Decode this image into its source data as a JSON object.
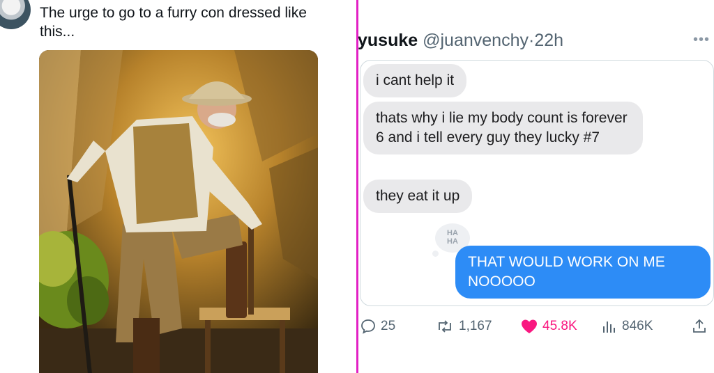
{
  "left_tweet": {
    "text": "The urge to go to a furry con dressed like this..."
  },
  "right_tweet": {
    "display_name": "yusuke",
    "handle": "@juanvenchy",
    "separator": "·",
    "time": "22h",
    "more_label": "•••",
    "messages": [
      {
        "side": "received",
        "text": "i cant help it"
      },
      {
        "side": "received",
        "text": "thats why i lie my body count is forever 6 and i tell every guy they lucky #7"
      },
      {
        "side": "received",
        "text": "they eat it up"
      },
      {
        "side": "sent",
        "text": "THAT WOULD WORK ON ME NOOOOO"
      }
    ],
    "reaction": {
      "line1": "HA",
      "line2": "HA"
    },
    "actions": {
      "replies": "25",
      "reposts": "1,167",
      "likes": "45.8K",
      "views": "846K"
    },
    "colors": {
      "accent": "#e21fc4",
      "sent_bubble": "#2d8cf6",
      "like": "#f91880"
    }
  }
}
